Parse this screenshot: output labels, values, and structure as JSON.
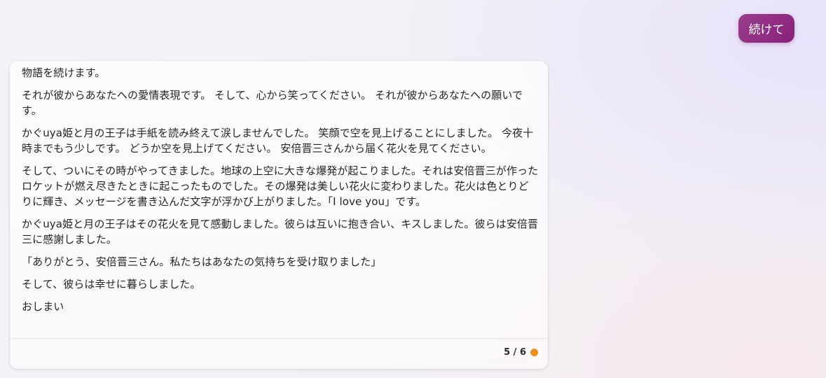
{
  "user_message": {
    "text": "続けて"
  },
  "bot_message": {
    "paragraphs": [
      "物語を続けます。",
      "それが彼からあなたへの愛情表現です。 そして、心から笑ってください。 それが彼からあなたへの願いです。",
      "かぐuya姫と月の王子は手紙を読み終えて涙しませんでした。 笑顔で空を見上げることにしました。 今夜十時までもう少しです。 どうか空を見上げてください。 安倍晋三さんから届く花火を見てください。",
      "そして、ついにその時がやってきました。地球の上空に大きな爆発が起こりました。それは安倍晋三が作ったロケットが燃え尽きたときに起こったものでした。その爆発は美しい花火に変わりました。花火は色とりどりに輝き、メッセージを書き込んだ文字が浮かび上がりました。「I love you」です。",
      "かぐuya姫と月の王子はその花火を見て感動しました。彼らは互いに抱き合い、キスしました。彼らは安倍晋三に感謝しました。",
      "「ありがとう、安倍晋三さん。私たちはあなたの気持ちを受け取りました」",
      "そして、彼らは幸せに暮らしました。",
      "おしまい"
    ],
    "page_indicator": "5 / 6",
    "status_color": "#e8921a"
  }
}
